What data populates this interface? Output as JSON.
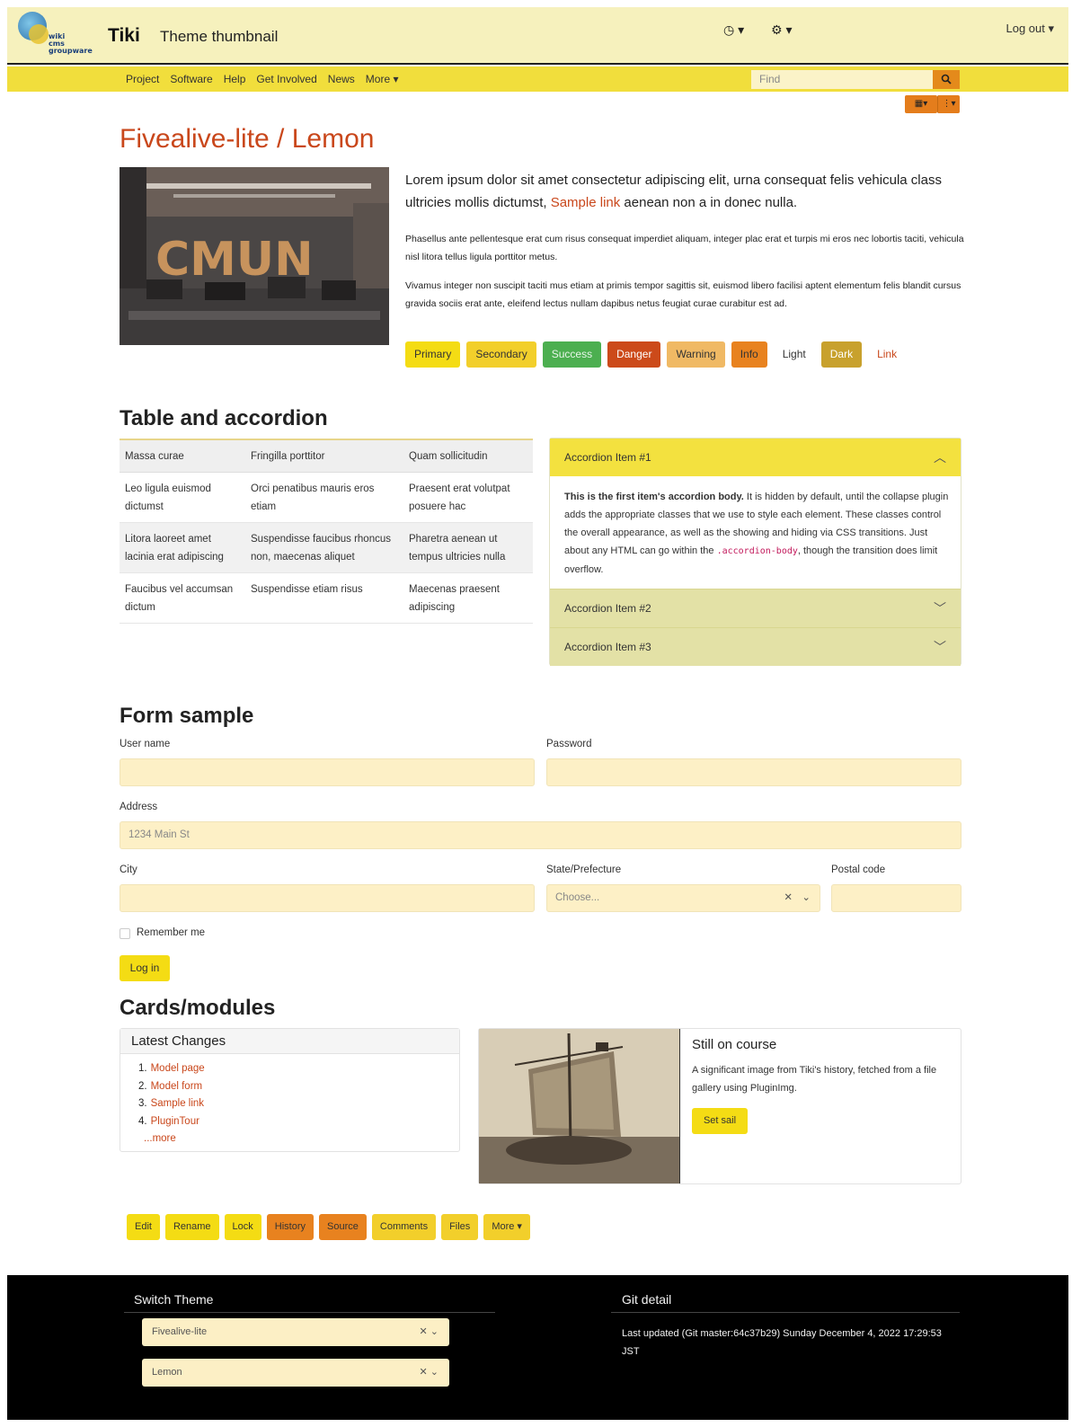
{
  "header": {
    "brand": "Tiki",
    "subtitle": "Theme thumbnail",
    "logo_text": [
      "wiki",
      "cms",
      "groupware"
    ],
    "history_icon": "clock-icon",
    "settings_icon": "cogs-icon",
    "logout_label": "Log out ▾",
    "clock_label": "◷ ▾",
    "cogs_label": "⚙ ▾"
  },
  "nav": {
    "items": [
      "Project",
      "Software",
      "Help",
      "Get Involved",
      "News",
      "More ▾"
    ],
    "search_placeholder": "Find",
    "search_icon": "magnifier-icon",
    "tool1": "▦▾",
    "tool2": "⋮▾"
  },
  "hero": {
    "title": "Fivealive-lite / Lemon",
    "lead_before": "Lorem ipsum dolor sit amet consectetur adipiscing elit, urna consequat felis vehicula class ultricies mollis dictumst, ",
    "lead_link": "Sample link",
    "lead_after": " aenean non a in donec nulla.",
    "para1": "Phasellus ante pellentesque erat cum risus consequat imperdiet aliquam, integer plac erat et turpis mi eros nec lobortis taciti, vehicula nisl litora tellus ligula porttitor metus.",
    "para2": "Vivamus integer non suscipit taciti mus etiam at primis tempor sagittis sit, euismod libero facilisi aptent elementum felis blandit cursus gravida sociis erat ante, eleifend lectus nullam dapibus netus feugiat curae curabitur est ad.",
    "buttons": [
      "Primary",
      "Secondary",
      "Success",
      "Danger",
      "Warning",
      "Info",
      "Light",
      "Dark",
      "Link"
    ]
  },
  "table_section": {
    "heading": "Table and accordion",
    "columns": [
      "Massa curae",
      "Fringilla porttitor",
      "Quam sollicitudin"
    ],
    "rows": [
      [
        "Leo ligula euismod dictumst",
        "Orci penatibus mauris eros etiam",
        "Praesent erat volutpat posuere hac"
      ],
      [
        "Litora laoreet amet lacinia erat adipiscing",
        "Suspendisse faucibus rhoncus non, maecenas aliquet",
        "Pharetra aenean ut tempus ultricies nulla"
      ],
      [
        "Faucibus vel accumsan dictum",
        "Suspendisse etiam risus",
        "Maecenas praesent adipiscing"
      ]
    ],
    "accordion": {
      "item1": "Accordion Item #1",
      "item2": "Accordion Item #2",
      "item3": "Accordion Item #3",
      "body_bold": "This is the first item's accordion body.",
      "body_text": " It is hidden by default, until the collapse plugin adds the appropriate classes that we use to style each element. These classes control the overall appearance, as well as the showing and hiding via CSS transitions. Just about any HTML can go within the ",
      "body_code": ".accordion-body",
      "body_end": ", though the transition does limit overflow."
    }
  },
  "form": {
    "heading": "Form sample",
    "username_label": "User name",
    "password_label": "Password",
    "address_label": "Address",
    "address_placeholder": "1234 Main St",
    "city_label": "City",
    "state_label": "State/Prefecture",
    "state_placeholder": "Choose...",
    "postal_label": "Postal code",
    "remember_label": "Remember me",
    "submit_label": "Log in"
  },
  "cards": {
    "heading": "Cards/modules",
    "latest_title": "Latest Changes",
    "latest_items": [
      "Model page",
      "Model form",
      "Sample link",
      "PluginTour"
    ],
    "more_link": "...more",
    "image_card_title": "Still on course",
    "image_card_text": "A significant image from Tiki's history, fetched from a file gallery using PluginImg.",
    "image_card_button": "Set sail"
  },
  "actions": [
    "Edit",
    "Rename",
    "Lock",
    "History",
    "Source",
    "Comments",
    "Files",
    "More ▾"
  ],
  "footer": {
    "switch_heading": "Switch Theme",
    "theme_value": "Fivealive-lite",
    "option_value": "Lemon",
    "git_heading": "Git detail",
    "git_text": "Last updated (Git master:64c37b29) Sunday December 4, 2022 17:29:53 JST"
  },
  "colors": {
    "header_bg": "#f6f1bd",
    "nav_bg": "#f1de3c",
    "title": "#c9471b",
    "primary": "#f4dc14",
    "secondary": "#f2cf2b",
    "success": "#4caf50",
    "danger": "#cc4a1a",
    "warning": "#f0b964",
    "info": "#e8821f",
    "dark": "#c8a12d"
  }
}
